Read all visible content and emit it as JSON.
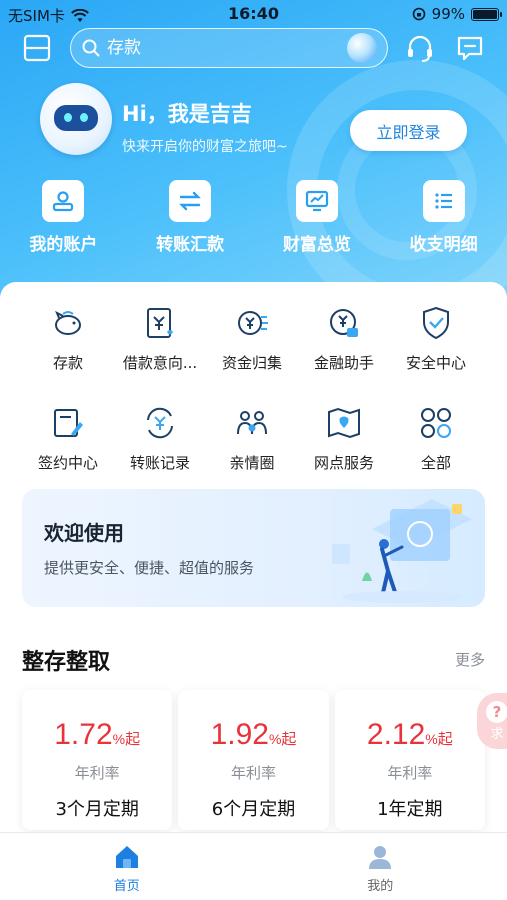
{
  "status_bar": {
    "carrier": "无SIM卡",
    "time": "16:40",
    "battery": "99%",
    "battery_level": 0.99
  },
  "header": {
    "search_placeholder": "存款"
  },
  "greeting": {
    "title": "Hi，我是吉吉",
    "subtitle": "快来开启你的财富之旅吧~",
    "login_label": "立即登录"
  },
  "quick_actions": [
    {
      "label": "我的账户",
      "icon": "account-icon"
    },
    {
      "label": "转账汇款",
      "icon": "transfer-icon"
    },
    {
      "label": "财富总览",
      "icon": "wealth-chart-icon"
    },
    {
      "label": "收支明细",
      "icon": "list-detail-icon"
    }
  ],
  "services": [
    {
      "label": "存款",
      "icon": "piggy-bank-icon"
    },
    {
      "label": "借款意向...",
      "icon": "loan-intent-icon"
    },
    {
      "label": "资金归集",
      "icon": "fund-collect-icon"
    },
    {
      "label": "金融助手",
      "icon": "finance-assistant-icon"
    },
    {
      "label": "安全中心",
      "icon": "shield-icon"
    },
    {
      "label": "签约中心",
      "icon": "sign-document-icon"
    },
    {
      "label": "转账记录",
      "icon": "transfer-record-icon"
    },
    {
      "label": "亲情圈",
      "icon": "family-circle-icon"
    },
    {
      "label": "网点服务",
      "icon": "map-branch-icon"
    },
    {
      "label": "全部",
      "icon": "all-apps-icon"
    }
  ],
  "welcome_banner": {
    "title": "欢迎使用",
    "subtitle": "提供更安全、便捷、超值的服务"
  },
  "deposit_section": {
    "title": "整存整取",
    "more_label": "更多",
    "products": [
      {
        "rate": "1.72",
        "unit": "%",
        "suffix": "起",
        "rate_label": "年利率",
        "term": "3个月定期"
      },
      {
        "rate": "1.92",
        "unit": "%",
        "suffix": "起",
        "rate_label": "年利率",
        "term": "6个月定期"
      },
      {
        "rate": "2.12",
        "unit": "%",
        "suffix": "起",
        "rate_label": "年利率",
        "term": "1年定期"
      }
    ]
  },
  "float_help": {
    "label": "求",
    "icon_text": "?"
  },
  "tab_bar": [
    {
      "label": "首页",
      "active": true
    },
    {
      "label": "我的",
      "active": false
    }
  ],
  "colors": {
    "brand_blue": "#1d7fe0",
    "hero_blue": "#2aa7f5",
    "rate_red": "#e8333a"
  }
}
